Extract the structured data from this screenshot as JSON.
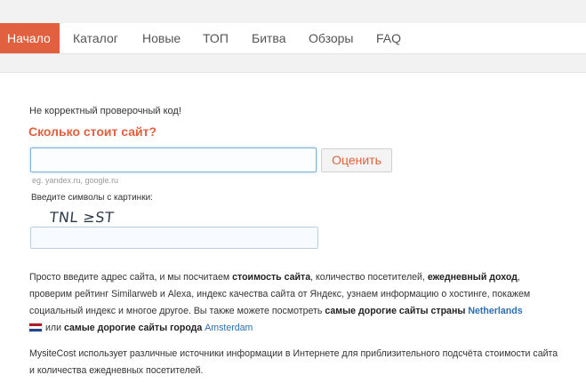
{
  "nav": {
    "items": [
      {
        "label": "Начало",
        "active": true
      },
      {
        "label": "Каталог"
      },
      {
        "label": "Новые"
      },
      {
        "label": "ТОП"
      },
      {
        "label": "Битва"
      },
      {
        "label": "Обзоры"
      },
      {
        "label": "FAQ"
      }
    ]
  },
  "form": {
    "error": "Не корректный проверочный код!",
    "heading": "Сколько стоит сайт?",
    "site_input_value": "",
    "button_label": "Оценить",
    "hint": "eg. yandex.ru, google.ru",
    "captcha_label": "Введите символы с картинки:",
    "captcha_text": "TNL ≥ST",
    "captcha_input_value": ""
  },
  "description": {
    "p1_a": "Просто введите адрес сайта, и мы посчитаем ",
    "p1_b": "стоимость сайта",
    "p1_c": ", количество посетителей, ",
    "p1_d": "ежедневный доход",
    "p1_e": ", проверим рейтинг Similarweb и Alexa, индекс качества сайта от Яндекс, узнаем информацию о хостинге, покажем социальный индекс и многое другое. Вы также можете посмотреть ",
    "p1_f": "самые дорогие сайты страны",
    "p1_country": "Netherlands",
    "p1_g": "или ",
    "p1_h": "самые дорогие сайты города",
    "p1_city": "Amsterdam",
    "p2": "MysiteCost использует различные источники информации в Интернете для приблизительного подсчёта стоимости сайта и количества ежедневных посетителей."
  },
  "colors": {
    "accent": "#e0603f",
    "link": "#2a6fb0"
  },
  "icons": {
    "flag": "netherlands-flag-icon"
  }
}
